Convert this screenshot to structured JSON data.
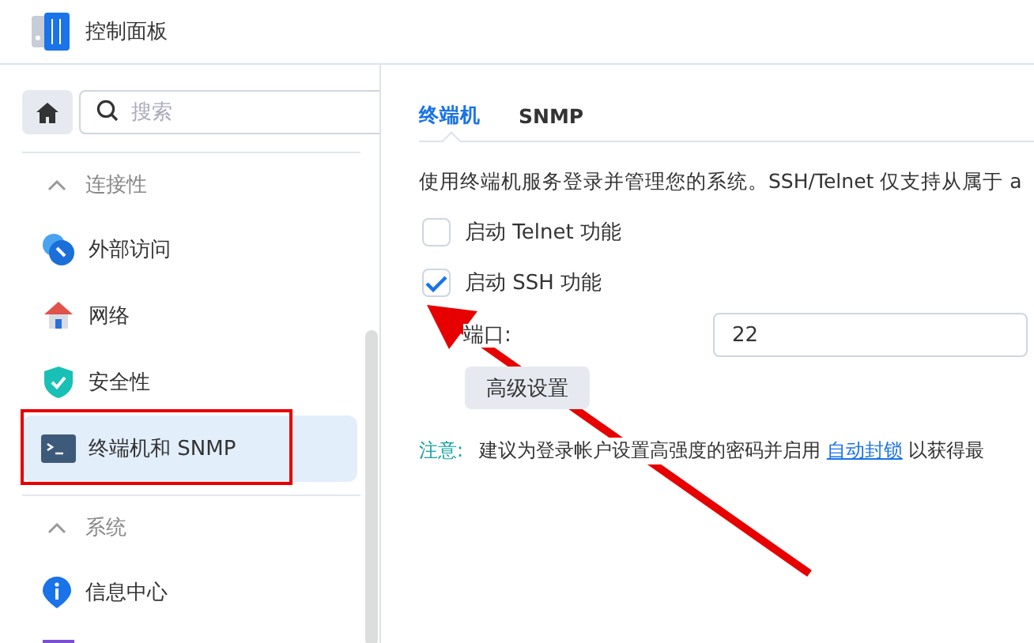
{
  "window": {
    "title": "控制面板"
  },
  "sidebar": {
    "search": {
      "placeholder": "搜索"
    },
    "groups": [
      {
        "label": "连接性",
        "expanded": true,
        "items": [
          {
            "label": "外部访问",
            "kind": "globe",
            "selected": false
          },
          {
            "label": "网络",
            "kind": "house",
            "selected": false
          },
          {
            "label": "安全性",
            "kind": "shield",
            "selected": false
          },
          {
            "label": "终端机和 SNMP",
            "kind": "terminal",
            "selected": true
          }
        ]
      },
      {
        "label": "系统",
        "expanded": true,
        "items": [
          {
            "label": "信息中心",
            "kind": "info",
            "selected": false
          }
        ]
      }
    ]
  },
  "tabs": [
    {
      "label": "终端机",
      "selected": true
    },
    {
      "label": "SNMP",
      "selected": false
    }
  ],
  "description": "使用终端机服务登录并管理您的系统。SSH/Telnet 仅支持从属于 a",
  "options": [
    {
      "label": "启动 Telnet 功能",
      "checked": false
    },
    {
      "label": "启动 SSH 功能",
      "checked": true
    }
  ],
  "port": {
    "label": "端口:",
    "value": "22"
  },
  "advanced_button": "高级设置",
  "note": {
    "label": "注意:",
    "before": "建议为登录帐户设置高强度的密码并启用",
    "link": "自动封锁",
    "after": "以获得最"
  },
  "annotations": {
    "highlight_frame": true,
    "arrow": true
  }
}
